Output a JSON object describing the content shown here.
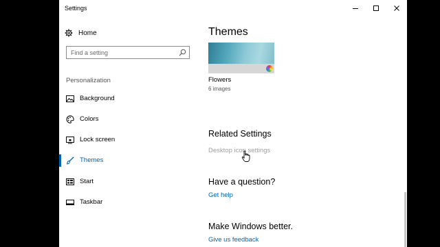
{
  "window": {
    "title": "Settings"
  },
  "controls": {
    "minimize": "minimize",
    "maximize": "maximize",
    "close": "close"
  },
  "sidebar": {
    "home_label": "Home",
    "search_placeholder": "Find a setting",
    "section_label": "Personalization",
    "items": [
      {
        "label": "Background",
        "icon": "image-icon",
        "active": false
      },
      {
        "label": "Colors",
        "icon": "palette-icon",
        "active": false
      },
      {
        "label": "Lock screen",
        "icon": "lock-screen-icon",
        "active": false
      },
      {
        "label": "Themes",
        "icon": "brush-icon",
        "active": true
      },
      {
        "label": "Start",
        "icon": "start-icon",
        "active": false
      },
      {
        "label": "Taskbar",
        "icon": "taskbar-icon",
        "active": false
      }
    ]
  },
  "main": {
    "title": "Themes",
    "theme": {
      "name": "Flowers",
      "count": "6 images"
    },
    "related": {
      "heading": "Related Settings",
      "link": "Desktop icon settings"
    },
    "question": {
      "heading": "Have a question?",
      "link": "Get help"
    },
    "feedback": {
      "heading": "Make Windows better.",
      "link": "Give us feedback"
    }
  },
  "colors": {
    "accent": "#0063b1",
    "disabled": "#a0a0a0"
  }
}
